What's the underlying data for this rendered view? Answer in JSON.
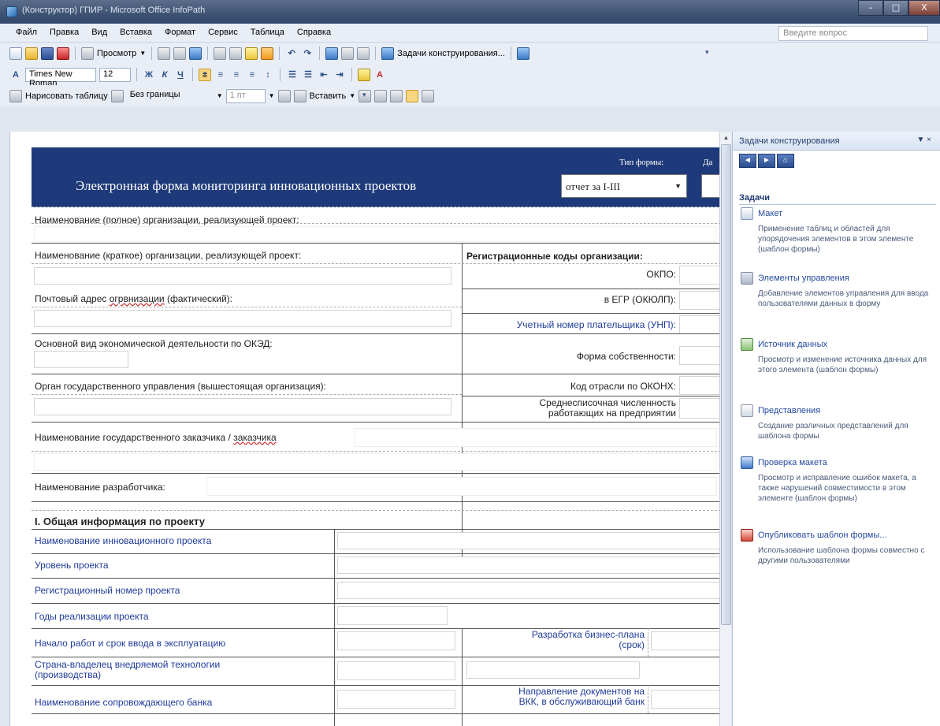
{
  "window": {
    "title": "(Конструктор) ГПИР - Microsoft Office InfoPath",
    "minimize": "–",
    "maximize": "□",
    "close": "X"
  },
  "menubar": {
    "items": [
      "Файл",
      "Правка",
      "Вид",
      "Вставка",
      "Формат",
      "Сервис",
      "Таблица",
      "Справка"
    ],
    "ask_placeholder": "Введите вопрос"
  },
  "toolbar_standard": {
    "preview_label": "Просмотр",
    "design_tasks_label": "Задачи конструирования..."
  },
  "toolbar_formatting": {
    "font_name": "Times New Roman",
    "font_size": "12"
  },
  "toolbar_table": {
    "draw_table_label": "Нарисовать таблицу",
    "border_label": "Без границы",
    "line_width": "1 пт",
    "insert_label": "Вставить"
  },
  "form": {
    "header_title": "Электронная форма мониторинга инновационных проектов",
    "form_type_label": "Тип формы:",
    "form_type_value": "отчет за I-III",
    "date_label": "Да",
    "org_full_name_label": "Наименование (полное) организации, реализующей проект:",
    "org_short_name_label": "Наименование (краткое) организации, реализующей проект:",
    "reg_codes_label": "Регистрационные коды организации:",
    "okpo_label": "ОКПО:",
    "egr_label": "в ЕГР (ОКЮЛП):",
    "postal_prefix": "Почтовый адрес ",
    "postal_misspelled": "огрвнизации",
    "postal_suffix": " (фактический):",
    "unp_label": "Учетный номер плательщика (УНП):",
    "okzd_label": "Основной вид экономической деятельности по ОКЭД:",
    "ownership_label": "Форма собственности:",
    "gov_body_label": "Орган государственного управления (вышестоящая организация):",
    "okonh_label": "Код отрасли по ОКОНХ:",
    "avg_staff_label_1": "Среднесписочная численность",
    "avg_staff_label_2": "работающих на предприятии",
    "customer_prefix": "Наименование государственного заказчика / ",
    "customer_word": "заказчика",
    "developer_label": "Наименование разработчика:",
    "section1_title": "I. Общая информация по проекту",
    "project_name_label": "Наименование инновационного проекта",
    "project_level_label": "Уровень проекта",
    "project_regnum_label": "Регистрационный номер проекта",
    "project_years_label": "Годы реализации проекта",
    "project_start_label": "Начало работ и срок ввода в эксплуатацию",
    "bizplan_label_1": "Разработка бизнес-плана",
    "bizplan_label_2": "(срок)",
    "country_label_1": "Страна-владелец внедряемой технологии",
    "country_label_2": "(производства)",
    "bank_label": "Наименование сопровождающего банка",
    "docs_label_1": "Направление документов на",
    "docs_label_2": "ВКК, в обслуживающий банк"
  },
  "taskpane": {
    "title": "Задачи конструирования",
    "section": "Задачи",
    "items": [
      {
        "link": "Макет",
        "desc": "Применение таблиц и областей для упорядочения элементов в этом элементе (шаблон формы)",
        "icon": "layout-icon"
      },
      {
        "link": "Элементы управления",
        "desc": "Добавление элементов управления для ввода пользователями данных в форму",
        "icon": "controls-icon"
      },
      {
        "link": "Источник данных",
        "desc": "Просмотр и изменение источника данных для этого элемента (шаблон формы)",
        "icon": "data-source-icon"
      },
      {
        "link": "Представления",
        "desc": "Создание различных представлений для шаблона формы",
        "icon": "views-icon"
      },
      {
        "link": "Проверка макета",
        "desc": "Просмотр и исправление ошибок макета, а также нарушений совместимости в этом элементе (шаблон формы)",
        "icon": "design-checker-icon"
      },
      {
        "link": "Опубликовать шаблон формы...",
        "desc": "Использование шаблона формы совместно с другими пользователями",
        "icon": "publish-icon"
      }
    ]
  }
}
